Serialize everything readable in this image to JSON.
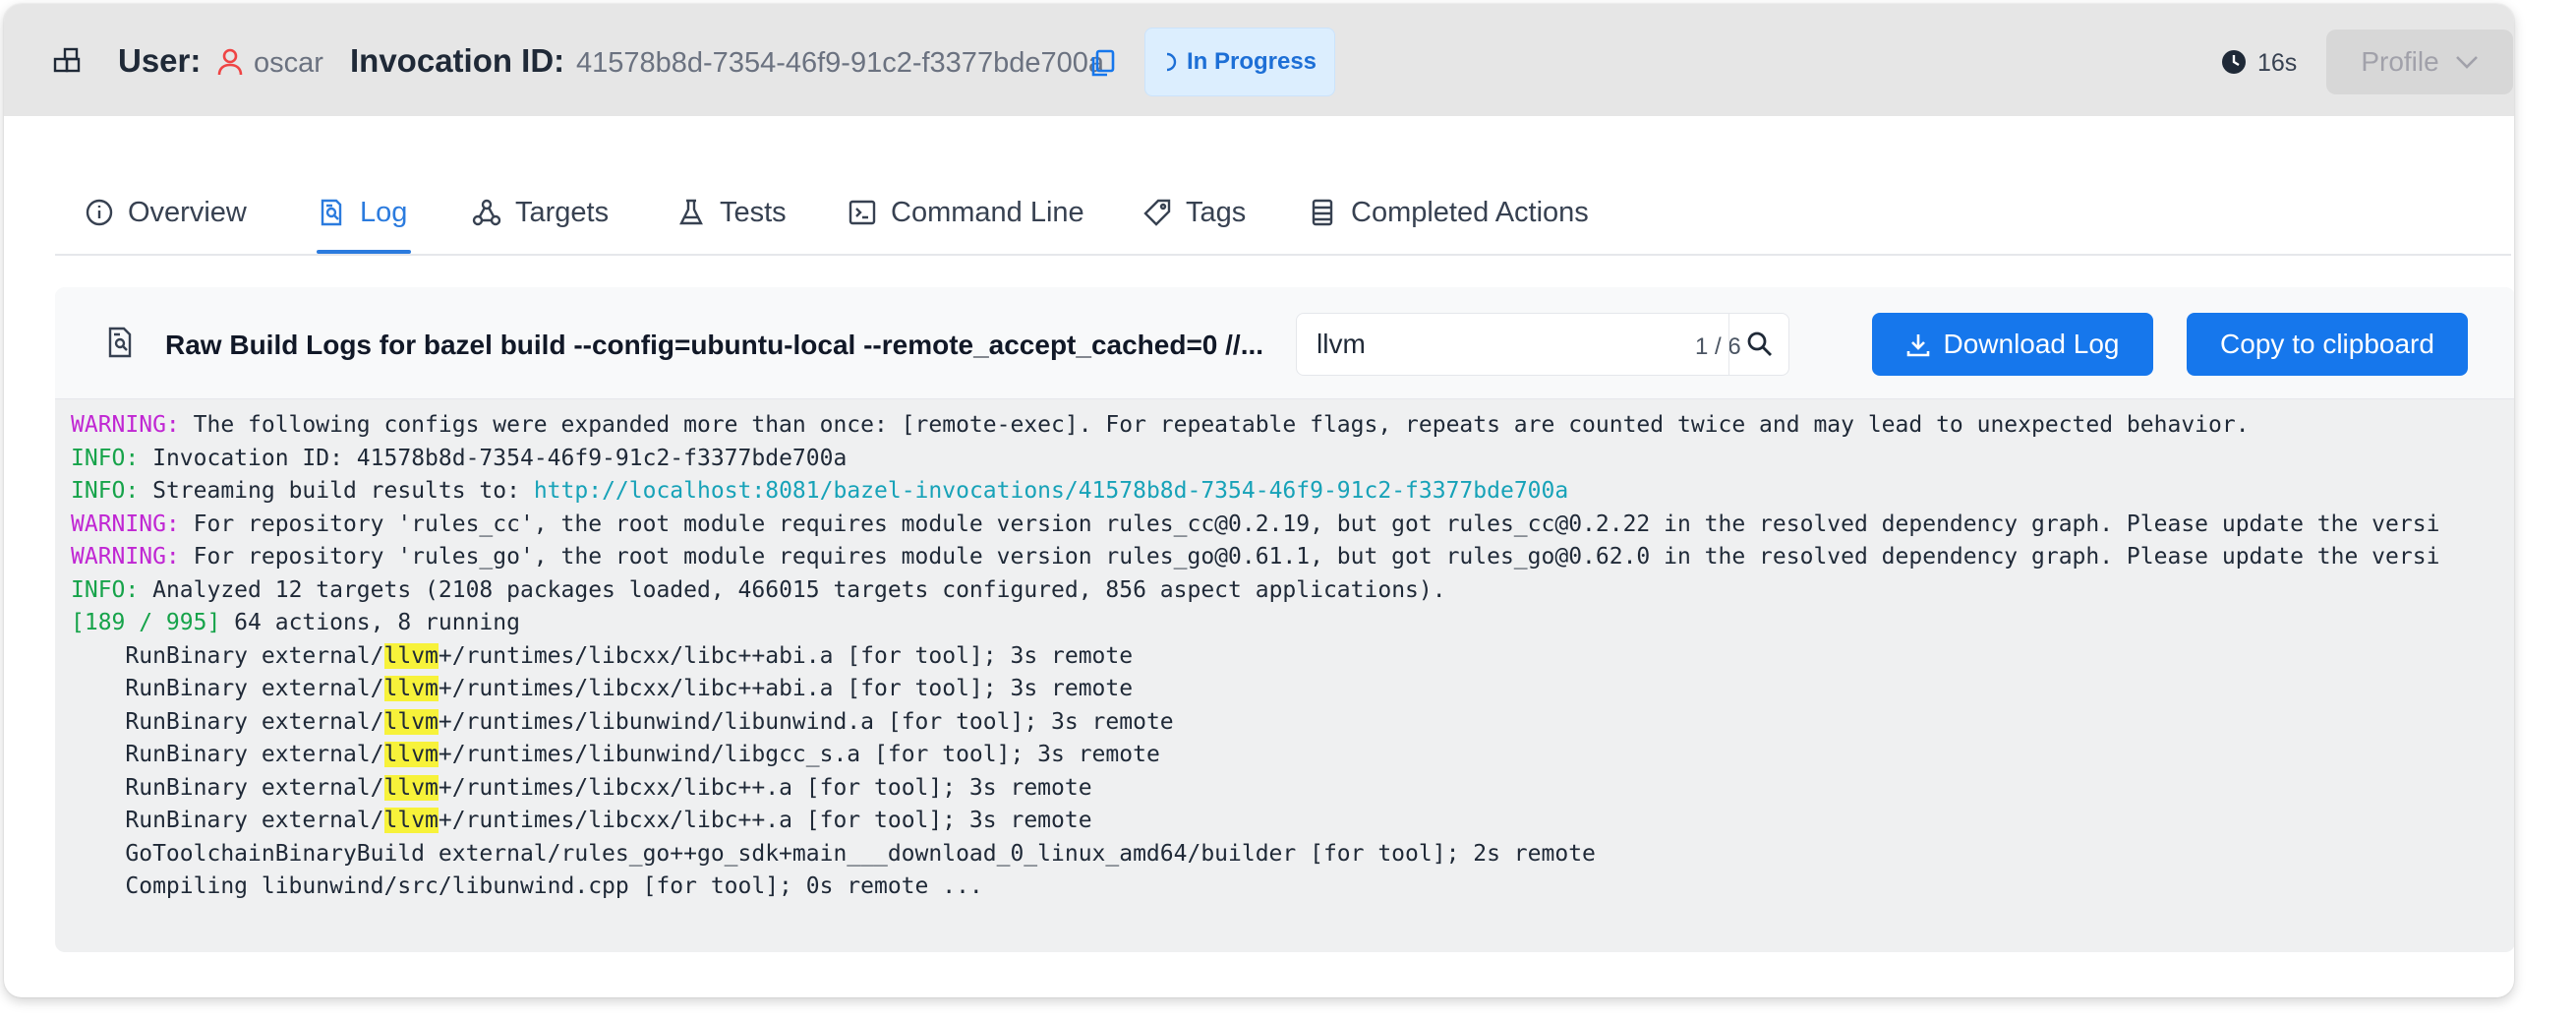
{
  "header": {
    "user_label": "User:",
    "user_name": "oscar",
    "invocation_label": "Invocation ID:",
    "invocation_id": "41578b8d-7354-46f9-91c2-f3377bde700a",
    "status": "In Progress",
    "duration": "16s",
    "profile_label": "Profile"
  },
  "tabs": [
    {
      "label": "Overview",
      "icon": "info-icon"
    },
    {
      "label": "Log",
      "icon": "log-search-icon",
      "active": true
    },
    {
      "label": "Targets",
      "icon": "targets-icon"
    },
    {
      "label": "Tests",
      "icon": "flask-icon"
    },
    {
      "label": "Command Line",
      "icon": "terminal-icon"
    },
    {
      "label": "Tags",
      "icon": "tag-icon"
    },
    {
      "label": "Completed Actions",
      "icon": "list-icon"
    }
  ],
  "log_panel": {
    "title": "Raw Build Logs for bazel build --config=ubuntu-local --remote_accept_cached=0 //...",
    "search_value": "llvm",
    "match_count": "1 / 6",
    "download_label": "Download Log",
    "copy_label": "Copy to clipboard"
  },
  "colors": {
    "warning": "#c026d3",
    "info": "#16a34a",
    "progress": "#16a34a",
    "link": "#17a2b8",
    "highlight": "#f7f23a",
    "primary": "#1677ec",
    "status_bg": "#dceefe"
  },
  "log_lines": [
    [
      {
        "t": "WARNING:",
        "c": "warning"
      },
      {
        "t": " The following configs were expanded more than once: [remote-exec]. For repeatable flags, repeats are counted twice and may lead to unexpected behavior."
      }
    ],
    [
      {
        "t": "INFO:",
        "c": "info"
      },
      {
        "t": " Invocation ID: 41578b8d-7354-46f9-91c2-f3377bde700a"
      }
    ],
    [
      {
        "t": "INFO:",
        "c": "info"
      },
      {
        "t": " Streaming build results to: "
      },
      {
        "t": "http://localhost:8081/bazel-invocations/41578b8d-7354-46f9-91c2-f3377bde700a",
        "c": "link"
      }
    ],
    [
      {
        "t": "WARNING:",
        "c": "warning"
      },
      {
        "t": " For repository 'rules_cc', the root module requires module version rules_cc@0.2.19, but got rules_cc@0.2.22 in the resolved dependency graph. Please update the versi"
      }
    ],
    [
      {
        "t": "WARNING:",
        "c": "warning"
      },
      {
        "t": " For repository 'rules_go', the root module requires module version rules_go@0.61.1, but got rules_go@0.62.0 in the resolved dependency graph. Please update the versi"
      }
    ],
    [
      {
        "t": "INFO:",
        "c": "info"
      },
      {
        "t": " Analyzed 12 targets (2108 packages loaded, 466015 targets configured, 856 aspect applications)."
      }
    ],
    [
      {
        "t": "[189 / 995]",
        "c": "progress"
      },
      {
        "t": " 64 actions, 8 running"
      }
    ],
    [
      {
        "t": "    RunBinary external/"
      },
      {
        "t": "llvm",
        "c": "highlight"
      },
      {
        "t": "+/runtimes/libcxx/libc++abi.a [for tool]; 3s remote"
      }
    ],
    [
      {
        "t": "    RunBinary external/"
      },
      {
        "t": "llvm",
        "c": "highlight"
      },
      {
        "t": "+/runtimes/libcxx/libc++abi.a [for tool]; 3s remote"
      }
    ],
    [
      {
        "t": "    RunBinary external/"
      },
      {
        "t": "llvm",
        "c": "highlight"
      },
      {
        "t": "+/runtimes/libunwind/libunwind.a [for tool]; 3s remote"
      }
    ],
    [
      {
        "t": "    RunBinary external/"
      },
      {
        "t": "llvm",
        "c": "highlight"
      },
      {
        "t": "+/runtimes/libunwind/libgcc_s.a [for tool]; 3s remote"
      }
    ],
    [
      {
        "t": "    RunBinary external/"
      },
      {
        "t": "llvm",
        "c": "highlight"
      },
      {
        "t": "+/runtimes/libcxx/libc++.a [for tool]; 3s remote"
      }
    ],
    [
      {
        "t": "    RunBinary external/"
      },
      {
        "t": "llvm",
        "c": "highlight"
      },
      {
        "t": "+/runtimes/libcxx/libc++.a [for tool]; 3s remote"
      }
    ],
    [
      {
        "t": "    GoToolchainBinaryBuild external/rules_go++go_sdk+main___download_0_linux_amd64/builder [for tool]; 2s remote"
      }
    ],
    [
      {
        "t": "    Compiling libunwind/src/libunwind.cpp [for tool]; 0s remote ..."
      }
    ]
  ]
}
